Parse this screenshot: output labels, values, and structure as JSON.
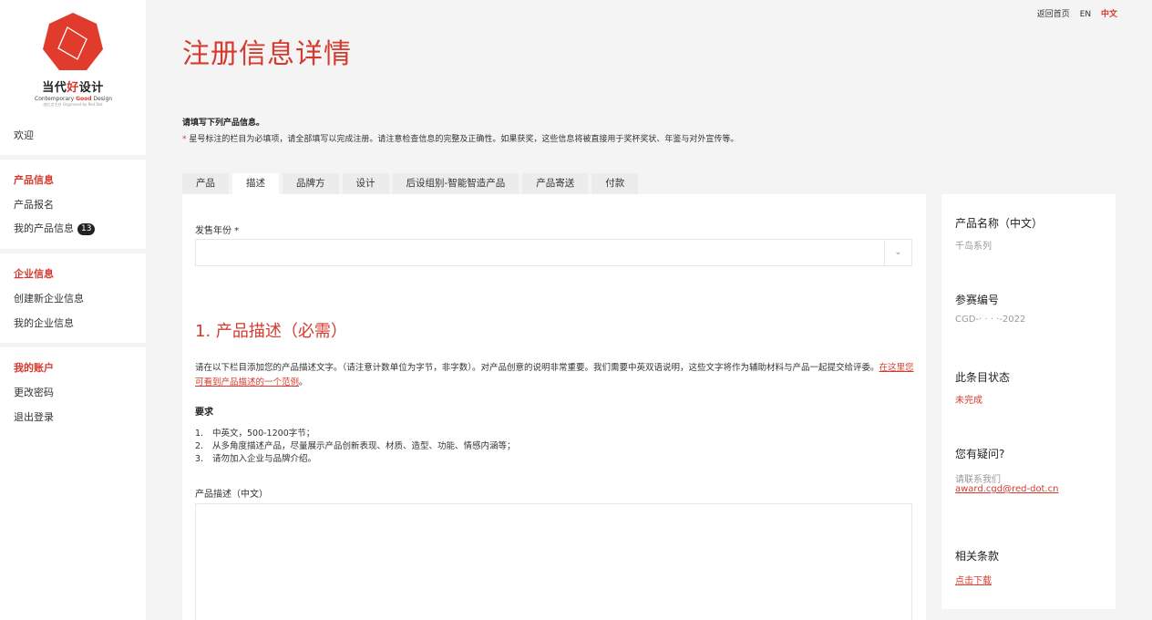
{
  "brand": {
    "title_pre": "当代",
    "title_hl": "好",
    "title_post": "设计",
    "sub_pre": "Contemporary ",
    "sub_hl": "Good",
    "sub_post": " Design",
    "tiny": "由红点主办 Organised by Red Dot",
    "accent": "#d63a2e"
  },
  "top_nav": {
    "home": "返回首页",
    "en": "EN",
    "zh": "中文"
  },
  "sidebar": {
    "welcome": "欢迎",
    "product_head": "产品信息",
    "product_register": "产品报名",
    "my_products": "我的产品信息",
    "my_products_count": "13",
    "company_head": "企业信息",
    "create_company": "创建新企业信息",
    "my_company": "我的企业信息",
    "account_head": "我的账户",
    "change_password": "更改密码",
    "logout": "退出登录"
  },
  "page": {
    "title": "注册信息详情",
    "intro_bold": "请填写下列产品信息。",
    "intro_star": "* ",
    "intro_text": "星号标注的栏目为必填项，请全部填写以完成注册。请注意检查信息的完整及正确性。如果获奖，这些信息将被直接用于奖杯奖状、年鉴与对外宣传等。"
  },
  "tabs": [
    "产品",
    "描述",
    "品牌方",
    "设计",
    "后设组别-智能智造产品",
    "产品寄送",
    "付款"
  ],
  "active_tab": "描述",
  "form": {
    "sale_year_label": "发售年份 *",
    "sale_year_value": "",
    "section_title": "1. 产品描述（必需）",
    "para_text": "请在以下栏目添加您的产品描述文字。（请注意计数单位为字节，非字数）。对产品创意的说明非常重要。我们需要中英双语说明，这些文字将作为辅助材料与产品一起提交给评委。",
    "para_link": "在这里您可看到产品描述的一个范例",
    "para_end": "。",
    "req_head": "要求",
    "requirements": [
      {
        "num": "1.",
        "text": "中英文，500-1200字节；"
      },
      {
        "num": "2.",
        "text": "从多角度描述产品，尽量展示产品创新表现、材质、造型、功能、情感内涵等；"
      },
      {
        "num": "3.",
        "text": "请勿加入企业与品牌介绍。"
      }
    ],
    "desc_cn_label": "产品描述（中文）",
    "desc_cn_value": ""
  },
  "info_panel": {
    "name_label": "产品名称（中文）",
    "name_value": "千岛系列",
    "id_label": "参赛编号",
    "id_value": "CGD-·  ·  · ·-2022",
    "status_label": "此条目状态",
    "status_value": "未完成",
    "question_label": "您有疑问?",
    "contact_text": "请联系我们",
    "contact_email": "award.cgd@red-dot.cn",
    "terms_label": "相关条款",
    "terms_link": "点击下载"
  }
}
